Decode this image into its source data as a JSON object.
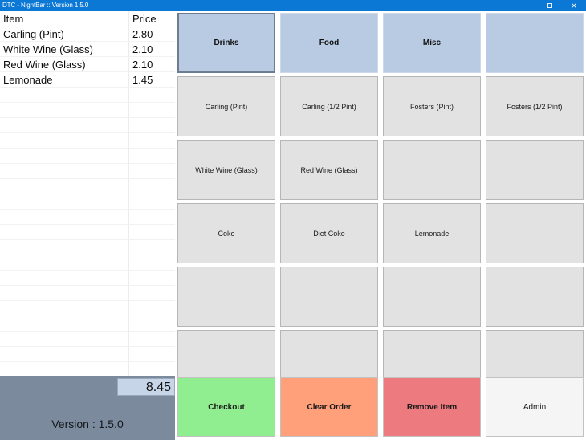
{
  "window": {
    "title": "DTC - NightBar :: Version 1.5.0",
    "controls": {
      "minimize": "minimize-icon",
      "maximize": "maximize-icon",
      "close": "close-icon"
    },
    "titlebar_color": "#0a78d4"
  },
  "order_list": {
    "headers": {
      "item": "Item",
      "price": "Price"
    },
    "rows": [
      {
        "item": "Carling (Pint)",
        "price": "2.80"
      },
      {
        "item": "White Wine (Glass)",
        "price": "2.10"
      },
      {
        "item": "Red Wine (Glass)",
        "price": "2.10"
      },
      {
        "item": "Lemonade",
        "price": "1.45"
      }
    ],
    "empty_row_count": 19
  },
  "total": {
    "value": "8.45",
    "version_text": "Version : 1.5.0",
    "panel_color": "#7b8a9c",
    "field_color": "#c7d5e8"
  },
  "categories": [
    {
      "label": "Drinks",
      "selected": true
    },
    {
      "label": "Food",
      "selected": false
    },
    {
      "label": "Misc",
      "selected": false
    },
    {
      "label": "",
      "selected": false
    }
  ],
  "products": [
    {
      "label": "Carling (Pint)"
    },
    {
      "label": "Carling (1/2 Pint)"
    },
    {
      "label": "Fosters (Pint)"
    },
    {
      "label": "Fosters (1/2 Pint)"
    },
    {
      "label": "White Wine (Glass)"
    },
    {
      "label": "Red Wine (Glass)"
    },
    {
      "label": ""
    },
    {
      "label": ""
    },
    {
      "label": "Coke"
    },
    {
      "label": "Diet Coke"
    },
    {
      "label": "Lemonade"
    },
    {
      "label": ""
    },
    {
      "label": ""
    },
    {
      "label": ""
    },
    {
      "label": ""
    },
    {
      "label": ""
    },
    {
      "label": ""
    },
    {
      "label": ""
    },
    {
      "label": ""
    },
    {
      "label": ""
    }
  ],
  "actions": [
    {
      "label": "Checkout",
      "color": "#90ee90",
      "style": "green"
    },
    {
      "label": "Clear Order",
      "color": "#ffa07a",
      "style": "orange"
    },
    {
      "label": "Remove Item",
      "color": "#ec7a7e",
      "style": "red"
    },
    {
      "label": "Admin",
      "color": "#f5f5f5",
      "style": "white"
    }
  ]
}
